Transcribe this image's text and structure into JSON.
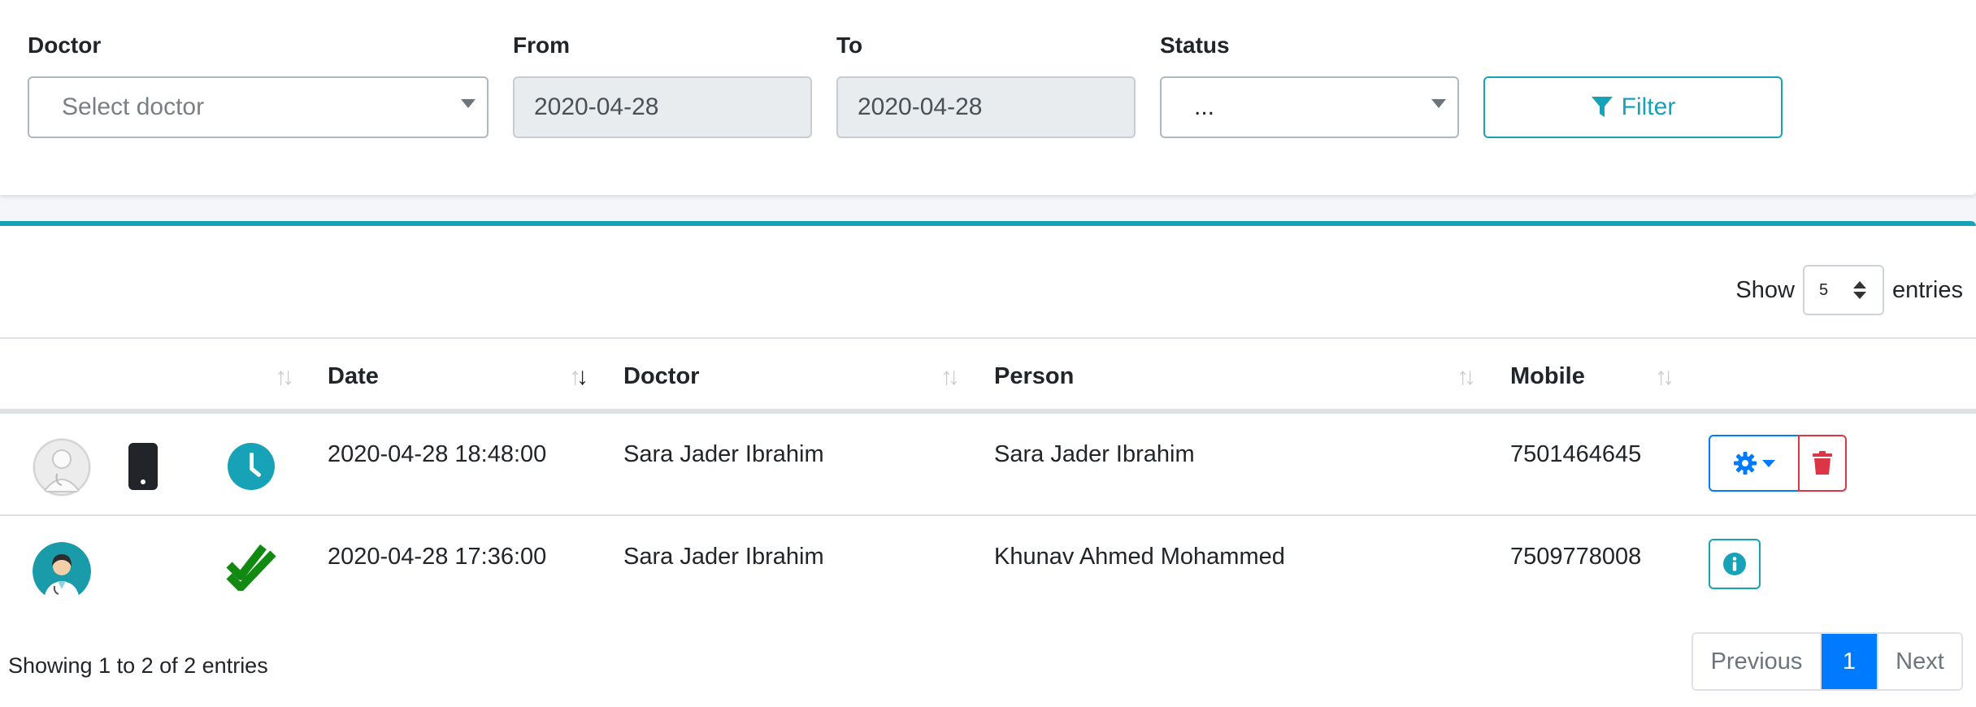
{
  "filters": {
    "doctor_label": "Doctor",
    "doctor_placeholder": "Select doctor",
    "from_label": "From",
    "from_value": "2020-04-28",
    "to_label": "To",
    "to_value": "2020-04-28",
    "status_label": "Status",
    "status_value": "...",
    "filter_button": "Filter"
  },
  "length_control": {
    "show_label": "Show",
    "value": "5",
    "entries_label": "entries"
  },
  "table": {
    "columns": [
      "",
      "Date",
      "Doctor",
      "Person",
      "Mobile",
      ""
    ],
    "sorted_column": "Date",
    "rows": [
      {
        "avatar": "doctor-avatar-gray",
        "source_icon": "mobile-phone-icon",
        "status_icon": "clock-icon",
        "date": "2020-04-28 18:48:00",
        "doctor": "Sara Jader Ibrahim",
        "person": "Sara Jader Ibrahim",
        "mobile": "7501464645",
        "actions": [
          "gear-dropdown",
          "delete"
        ]
      },
      {
        "avatar": "doctor-avatar-teal",
        "source_icon": "",
        "status_icon": "double-check-icon",
        "date": "2020-04-28 17:36:00",
        "doctor": "Sara Jader Ibrahim",
        "person": "Khunav Ahmed Mohammed",
        "mobile": "7509778008",
        "actions": [
          "info"
        ]
      }
    ]
  },
  "footer": {
    "info": "Showing 1 to 2 of 2 entries",
    "previous": "Previous",
    "current_page": "1",
    "next": "Next"
  },
  "colors": {
    "accent": "#17a2b8",
    "primary": "#007bff",
    "danger": "#dc3545",
    "success": "#128a12"
  }
}
